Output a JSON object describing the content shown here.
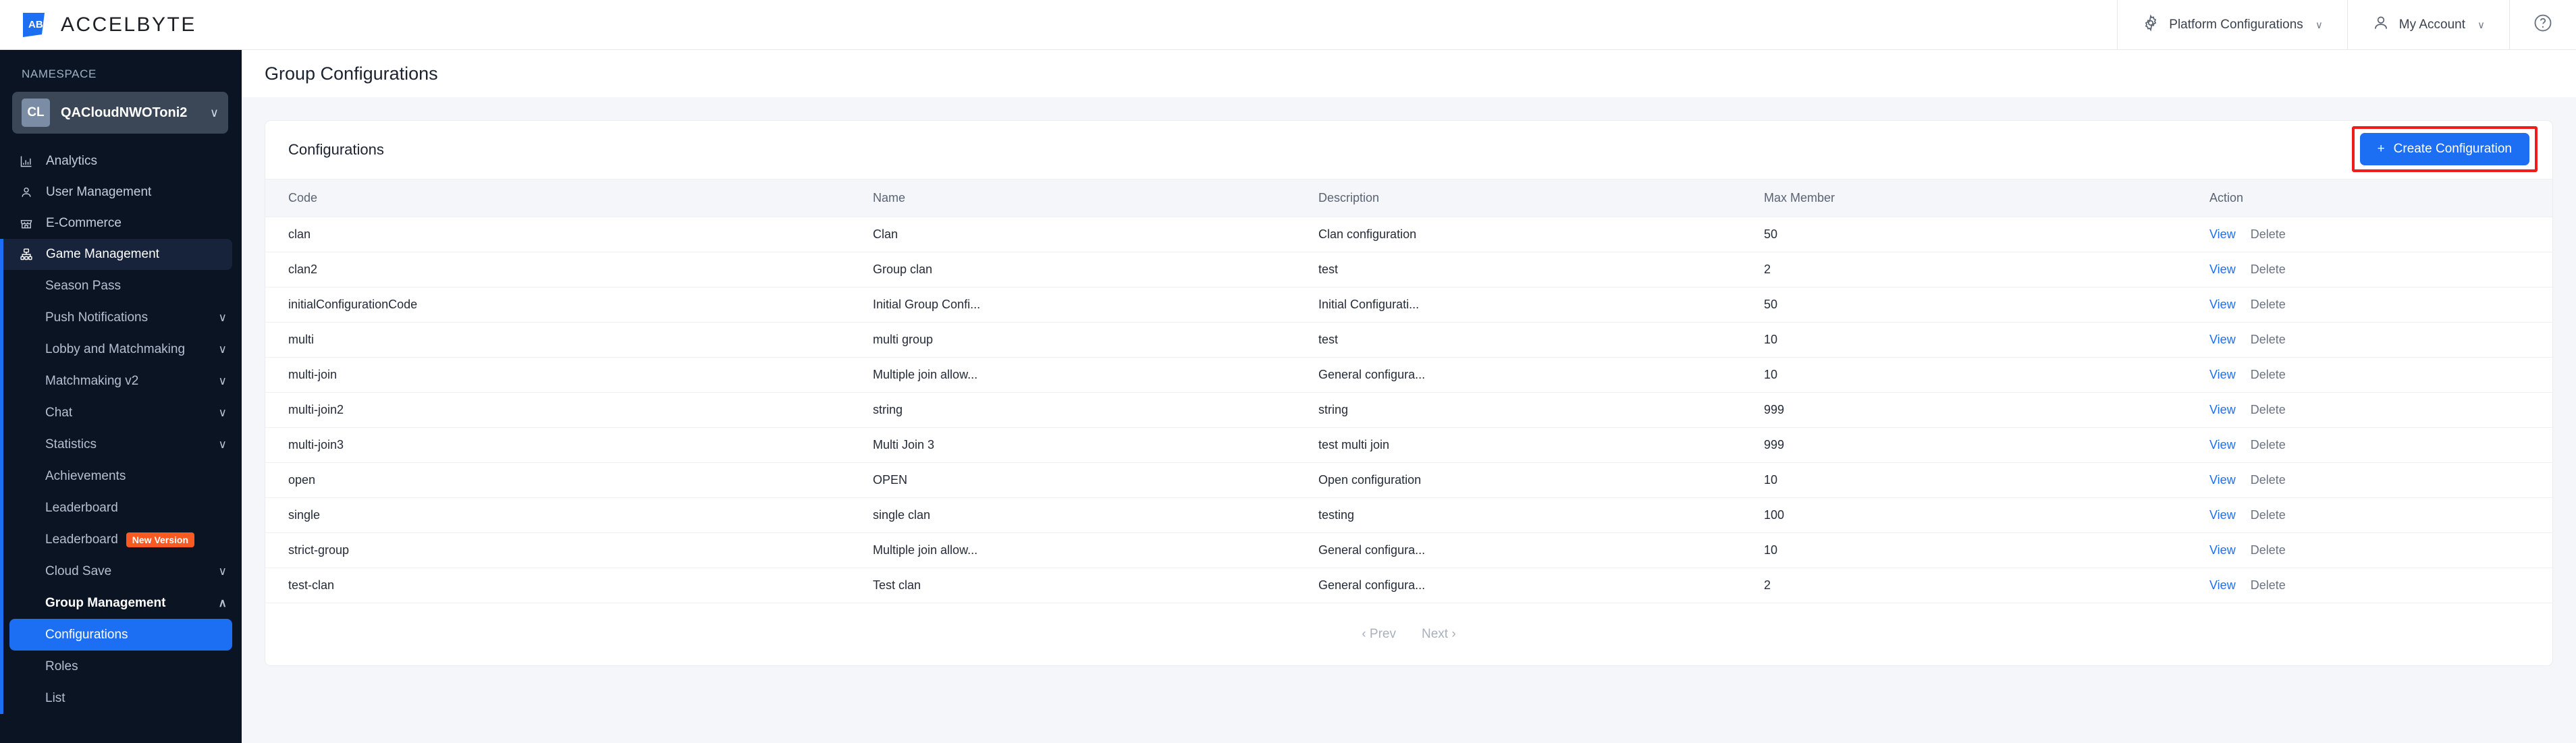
{
  "topbar": {
    "brand": "ACCELBYTE",
    "brand_icon": "accelbyte-logo-icon",
    "platform_config": "Platform Configurations",
    "platform_config_icon": "gear-icon",
    "my_account": "My Account",
    "my_account_icon": "user-icon",
    "help_icon": "help-circle-icon",
    "chevron": "∨"
  },
  "sidebar": {
    "namespace_label": "NAMESPACE",
    "namespace_badge": "CL",
    "namespace_name": "QACloudNWOToni2",
    "namespace_chevron": "∨",
    "top_items": [
      {
        "label": "Analytics",
        "icon": "chart-bar-icon",
        "active": false
      },
      {
        "label": "User Management",
        "icon": "user-icon",
        "active": false
      },
      {
        "label": "E-Commerce",
        "icon": "store-icon",
        "active": false
      },
      {
        "label": "Game Management",
        "icon": "sitemap-icon",
        "active": true
      }
    ],
    "sub_items": [
      {
        "label": "Season Pass",
        "chevron": ""
      },
      {
        "label": "Push Notifications",
        "chevron": "∨"
      },
      {
        "label": "Lobby and Matchmaking",
        "chevron": "∨"
      },
      {
        "label": "Matchmaking v2",
        "chevron": "∨"
      },
      {
        "label": "Chat",
        "chevron": "∨"
      },
      {
        "label": "Statistics",
        "chevron": "∨"
      },
      {
        "label": "Achievements",
        "chevron": ""
      },
      {
        "label": "Leaderboard",
        "chevron": ""
      },
      {
        "label": "Leaderboard",
        "chevron": "",
        "badge": "New Version"
      },
      {
        "label": "Cloud Save",
        "chevron": "∨"
      },
      {
        "label": "Group Management",
        "chevron": "∧",
        "bold": true
      },
      {
        "label": "Configurations",
        "chevron": "",
        "selected": true
      },
      {
        "label": "Roles",
        "chevron": ""
      },
      {
        "label": "List",
        "chevron": ""
      }
    ]
  },
  "page": {
    "title": "Group Configurations",
    "card_title": "Configurations",
    "create_button": "Create Configuration",
    "create_button_icon": "plus-icon"
  },
  "table": {
    "columns": [
      "Code",
      "Name",
      "Description",
      "Max Member",
      "Action"
    ],
    "action_view": "View",
    "action_delete": "Delete",
    "rows": [
      {
        "code": "clan",
        "name": "Clan",
        "description": "Clan configuration",
        "max_member": "50"
      },
      {
        "code": "clan2",
        "name": "Group clan",
        "description": "test",
        "max_member": "2"
      },
      {
        "code": "initialConfigurationCode",
        "name": "Initial Group Confi...",
        "description": "Initial Configurati...",
        "max_member": "50"
      },
      {
        "code": "multi",
        "name": "multi group",
        "description": "test",
        "max_member": "10"
      },
      {
        "code": "multi-join",
        "name": "Multiple join allow...",
        "description": "General configura...",
        "max_member": "10"
      },
      {
        "code": "multi-join2",
        "name": "string",
        "description": "string",
        "max_member": "999"
      },
      {
        "code": "multi-join3",
        "name": "Multi Join 3",
        "description": "test multi join",
        "max_member": "999"
      },
      {
        "code": "open",
        "name": "OPEN",
        "description": "Open configuration",
        "max_member": "10"
      },
      {
        "code": "single",
        "name": "single clan",
        "description": "testing",
        "max_member": "100"
      },
      {
        "code": "strict-group",
        "name": "Multiple join allow...",
        "description": "General configura...",
        "max_member": "10"
      },
      {
        "code": "test-clan",
        "name": "Test clan",
        "description": "General configura...",
        "max_member": "2"
      }
    ]
  },
  "pagination": {
    "prev": "Prev",
    "next": "Next",
    "prev_icon": "chevron-left-icon",
    "next_icon": "chevron-right-icon"
  },
  "colors": {
    "accent": "#1c6ef2",
    "sidebar_bg": "#0a1423",
    "badge_new": "#f95a21",
    "annotation": "#f21b1b"
  }
}
